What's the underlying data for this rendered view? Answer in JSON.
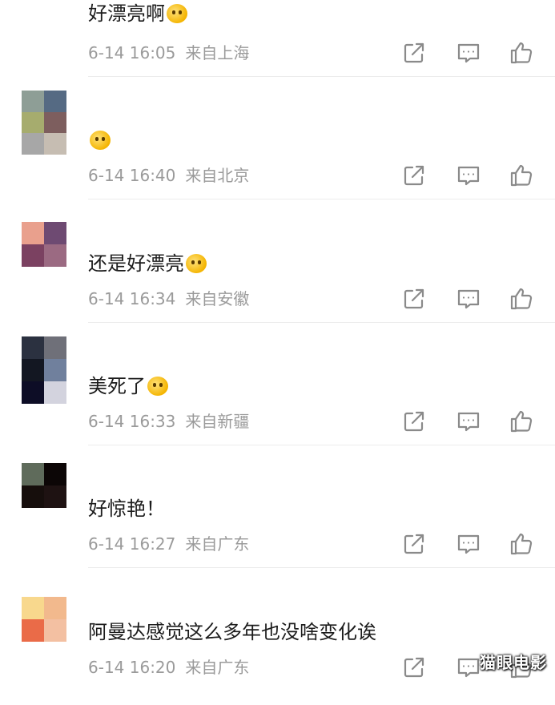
{
  "comments": [
    {
      "text": "好漂亮啊",
      "emoji": "crying-smile-emoji",
      "time": "6-14 16:05",
      "location": "来自上海",
      "avatar_colors": [
        "#3a3a3a",
        "#f4b21a",
        "#ffffff",
        "#ffffff"
      ]
    },
    {
      "text": "",
      "emoji": "cute-pig-emoji",
      "time": "6-14 16:40",
      "location": "来自北京",
      "avatar_colors": [
        "#8e9e96",
        "#556a83",
        "#a6ac6e",
        "#7d5e5e",
        "#a7a7a7",
        "#c6bdb2"
      ]
    },
    {
      "text": "还是好漂亮",
      "emoji": "drooling-emoji",
      "time": "6-14 16:34",
      "location": "来自安徽",
      "avatar_colors": [
        "#e9a08d",
        "#6e4a72",
        "#7b4161",
        "#9b6a82"
      ]
    },
    {
      "text": "美死了",
      "emoji": "heart-eyes-emoji",
      "time": "6-14 16:33",
      "location": "来自新疆",
      "avatar_colors": [
        "#2b3140",
        "#6f7079",
        "#131722",
        "#70809d",
        "#0d0d26",
        "#d3d3de"
      ]
    },
    {
      "text": "好惊艳！",
      "emoji": "",
      "time": "6-14 16:27",
      "location": "来自广东",
      "avatar_colors": [
        "#5f6b5b",
        "#0c0606",
        "#160e0c",
        "#1e1212"
      ]
    },
    {
      "text": "阿曼达感觉这么多年也没啥变化诶",
      "emoji": "",
      "time": "6-14 16:20",
      "location": "来自广东",
      "avatar_colors": [
        "#f8d88d",
        "#f2b98d",
        "#ea6b48",
        "#f3c0a2"
      ]
    }
  ],
  "icons": {
    "share": "share-icon",
    "comment": "comment-icon",
    "like": "thumbs-up-icon"
  },
  "watermark": "猫眼电影"
}
